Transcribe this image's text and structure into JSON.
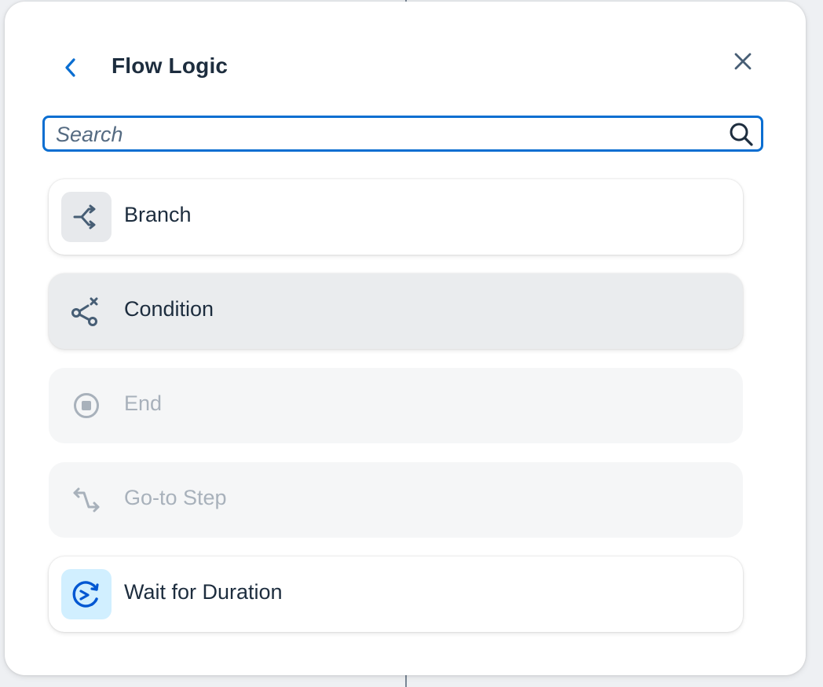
{
  "header": {
    "title": "Flow Logic"
  },
  "search": {
    "placeholder": "Search",
    "value": ""
  },
  "items": [
    {
      "label": "Branch",
      "icon": "branch-icon",
      "state": "normal"
    },
    {
      "label": "Condition",
      "icon": "condition-icon",
      "state": "hovered"
    },
    {
      "label": "End",
      "icon": "end-icon",
      "state": "disabled"
    },
    {
      "label": "Go-to Step",
      "icon": "go-to-step-icon",
      "state": "disabled"
    },
    {
      "label": "Wait for Duration",
      "icon": "wait-for-duration-icon",
      "state": "normal"
    }
  ],
  "colors": {
    "accent": "#0a6ed1",
    "text": "#1d2d3e",
    "icon": "#475e75",
    "disabled": "#a8b1bb",
    "wait_icon": "#0057d2"
  }
}
